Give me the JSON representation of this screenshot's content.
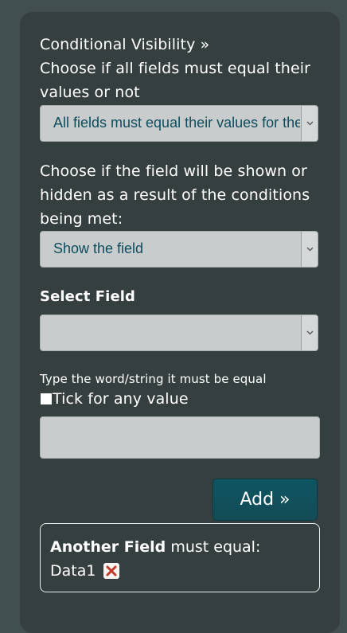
{
  "conditional": {
    "heading": "Conditional Visibility »",
    "match_prompt": "Choose if all fields must equal their values or not",
    "match_select_value": "All fields must equal their values for the field to be shown/hidden",
    "show_prompt": "Choose if the field will be shown or hidden as a result of the conditions being met:",
    "show_select_value": "Show the field",
    "select_field_label": "Select Field",
    "select_field_value": "",
    "string_label": "Type the word/string it must be equal",
    "any_value_label": "Tick for any value",
    "any_value_checked": false,
    "value_input": "",
    "add_button": "Add »"
  },
  "condition": {
    "field_name": "Another Field",
    "operator_text": "must equal:",
    "value": "Data1"
  },
  "colors": {
    "page_bg": "#414f4f",
    "panel_bg": "#363f40",
    "button_bg": "#0e5561",
    "select_text": "#0d4d5e",
    "remove_icon": "#c0392b"
  },
  "icons": {
    "dropdown": "chevron-down-icon",
    "remove": "close-x-icon"
  }
}
